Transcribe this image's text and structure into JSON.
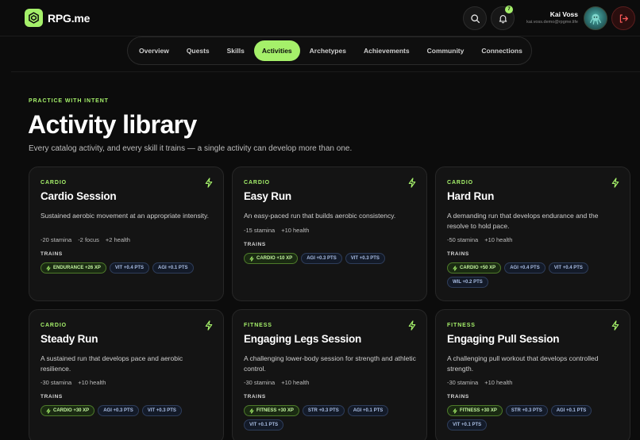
{
  "app": {
    "brand": "RPG.me"
  },
  "header": {
    "user_name": "Kai Voss",
    "user_email": "kai.voss.demo@rpgme.life",
    "notification_count": "7"
  },
  "nav": {
    "items": [
      {
        "label": "Overview"
      },
      {
        "label": "Quests"
      },
      {
        "label": "Skills"
      },
      {
        "label": "Activities",
        "active": true
      },
      {
        "label": "Archetypes"
      },
      {
        "label": "Achievements"
      },
      {
        "label": "Community"
      },
      {
        "label": "Connections"
      }
    ]
  },
  "page": {
    "eyebrow": "PRACTICE WITH INTENT",
    "title": "Activity library",
    "subtitle": "Every catalog activity, and every skill it trains — a single activity can develop more than one."
  },
  "trains_label": "TRAINS",
  "cards": [
    {
      "category": "CARDIO",
      "title": "Cardio Session",
      "description": "Sustained aerobic movement at an appropriate intensity.",
      "stats": [
        "-20 stamina",
        "-2 focus",
        "+2 health"
      ],
      "chips": [
        {
          "type": "xp",
          "label": "ENDURANCE +26 XP"
        },
        {
          "type": "pts",
          "label": "VIT +0.4 PTS"
        },
        {
          "type": "pts",
          "label": "AGI +0.1 PTS"
        }
      ]
    },
    {
      "category": "CARDIO",
      "title": "Easy Run",
      "description": "An easy-paced run that builds aerobic consistency.",
      "stats": [
        "-15 stamina",
        "+10 health"
      ],
      "chips": [
        {
          "type": "xp",
          "label": "CARDIO +10 XP"
        },
        {
          "type": "pts",
          "label": "AGI +0.3 PTS"
        },
        {
          "type": "pts",
          "label": "VIT +0.3 PTS"
        }
      ]
    },
    {
      "category": "CARDIO",
      "title": "Hard Run",
      "description": "A demanding run that develops endurance and the resolve to hold pace.",
      "stats": [
        "-50 stamina",
        "+10 health"
      ],
      "chips": [
        {
          "type": "xp",
          "label": "CARDIO +50 XP"
        },
        {
          "type": "pts",
          "label": "AGI +0.4 PTS"
        },
        {
          "type": "pts",
          "label": "VIT +0.4 PTS"
        },
        {
          "type": "pts",
          "label": "WIL +0.2 PTS"
        }
      ]
    },
    {
      "category": "CARDIO",
      "title": "Steady Run",
      "description": "A sustained run that develops pace and aerobic resilience.",
      "stats": [
        "-30 stamina",
        "+10 health"
      ],
      "chips": [
        {
          "type": "xp",
          "label": "CARDIO +30 XP"
        },
        {
          "type": "pts",
          "label": "AGI +0.3 PTS"
        },
        {
          "type": "pts",
          "label": "VIT +0.3 PTS"
        }
      ]
    },
    {
      "category": "FITNESS",
      "title": "Engaging Legs Session",
      "description": "A challenging lower-body session for strength and athletic control.",
      "stats": [
        "-30 stamina",
        "+10 health"
      ],
      "chips": [
        {
          "type": "xp",
          "label": "FITNESS +30 XP"
        },
        {
          "type": "pts",
          "label": "STR +0.3 PTS"
        },
        {
          "type": "pts",
          "label": "AGI +0.1 PTS"
        },
        {
          "type": "pts",
          "label": "VIT +0.1 PTS"
        }
      ]
    },
    {
      "category": "FITNESS",
      "title": "Engaging Pull Session",
      "description": "A challenging pull workout that develops controlled strength.",
      "stats": [
        "-30 stamina",
        "+10 health"
      ],
      "chips": [
        {
          "type": "xp",
          "label": "FITNESS +30 XP"
        },
        {
          "type": "pts",
          "label": "STR +0.3 PTS"
        },
        {
          "type": "pts",
          "label": "AGI +0.1 PTS"
        },
        {
          "type": "pts",
          "label": "VIT +0.1 PTS"
        }
      ]
    }
  ]
}
